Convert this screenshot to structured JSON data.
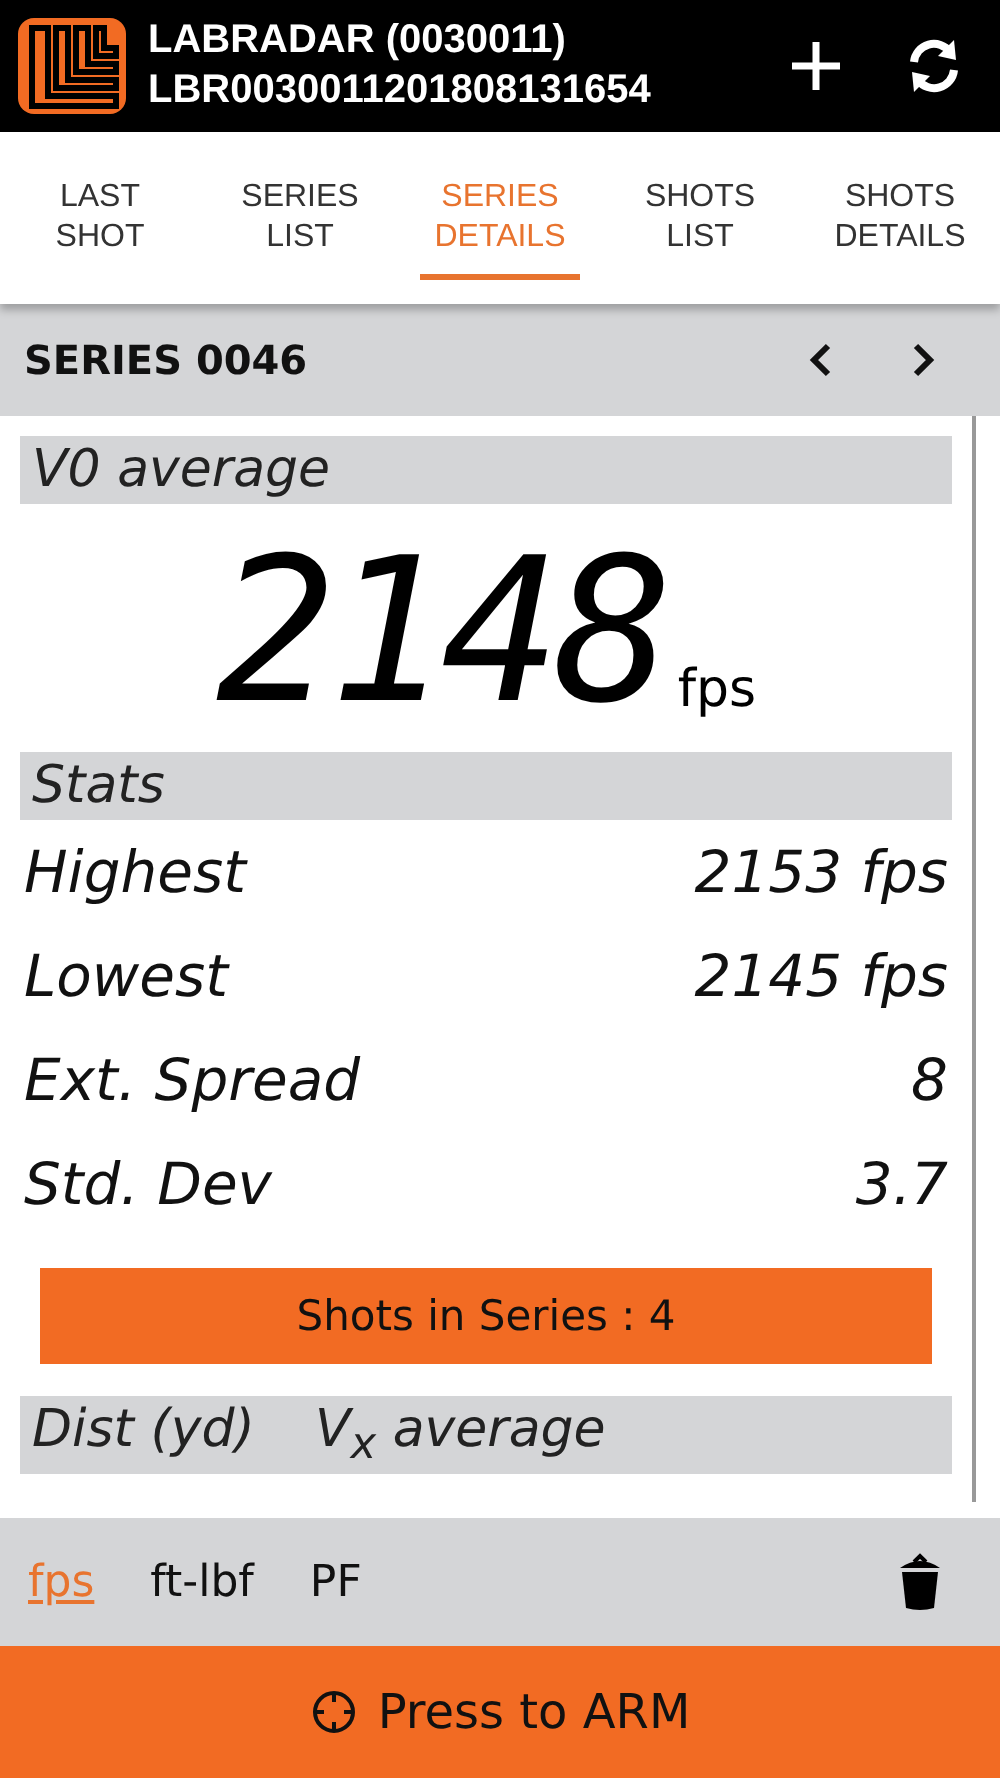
{
  "header": {
    "title": "LABRADAR (0030011)",
    "subtitle": "LBR0030011201808131654"
  },
  "tabs": [
    {
      "label": "LAST SHOT",
      "selected": false
    },
    {
      "label": "SERIES LIST",
      "selected": false
    },
    {
      "label": "SERIES DETAILS",
      "selected": true
    },
    {
      "label": "SHOTS LIST",
      "selected": false
    },
    {
      "label": "SHOTS DETAILS",
      "selected": false
    }
  ],
  "series": {
    "title": "SERIES 0046"
  },
  "average": {
    "heading": "V0 average",
    "value": "2148",
    "unit": "fps"
  },
  "stats": {
    "heading": "Stats",
    "rows": [
      {
        "label": "Highest",
        "value": "2153 fps"
      },
      {
        "label": "Lowest",
        "value": "2145 fps"
      },
      {
        "label": "Ext. Spread",
        "value": "8"
      },
      {
        "label": "Std. Dev",
        "value": "3.7"
      }
    ]
  },
  "shots_button": "Shots in Series : 4",
  "table": {
    "columns": [
      "Dist (yd)",
      "V$_{x}$ average"
    ]
  },
  "units": [
    {
      "label": "fps",
      "selected": true
    },
    {
      "label": "ft-lbf",
      "selected": false
    },
    {
      "label": "PF",
      "selected": false
    }
  ],
  "arm_button": "Press to ARM"
}
